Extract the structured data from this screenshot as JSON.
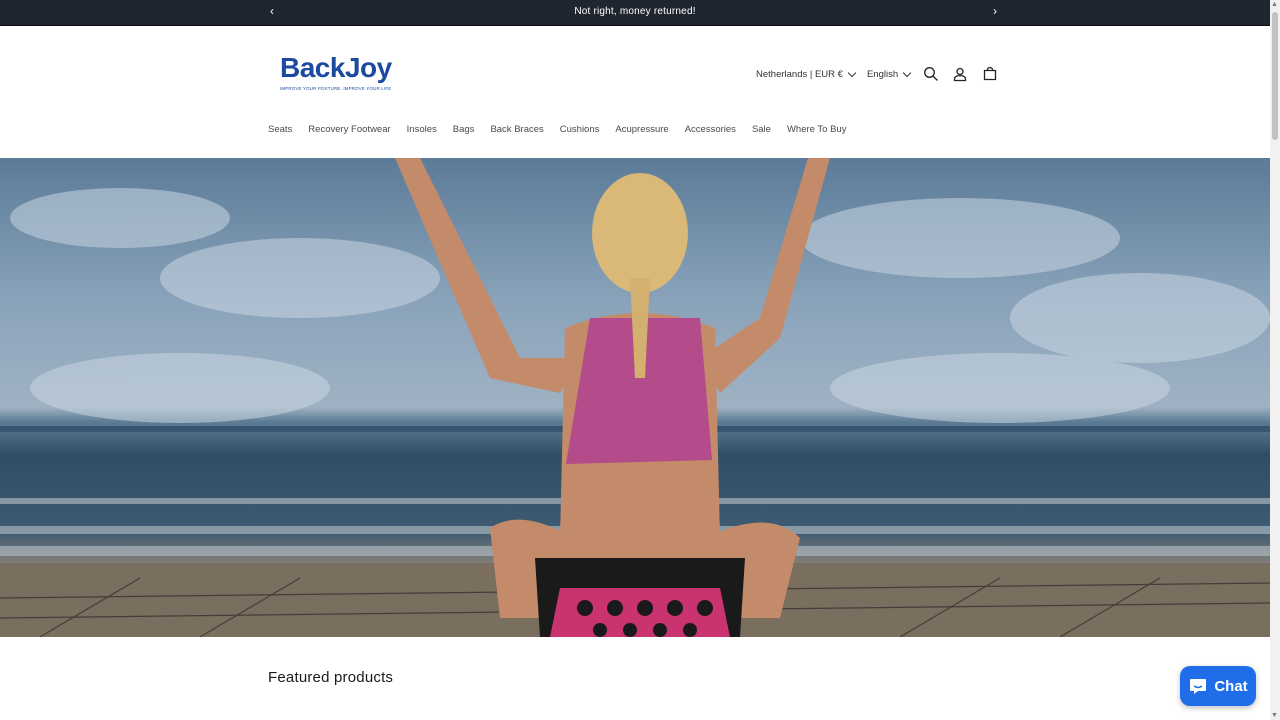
{
  "announcement": {
    "message": "Not right, money returned!",
    "prev_icon": "‹",
    "next_icon": "›"
  },
  "header": {
    "logo": {
      "name": "BackJoy",
      "tagline": "IMPROVE YOUR POSTURE. IMPROVE YOUR LIFE"
    },
    "country_selector": "Netherlands | EUR €",
    "language_selector": "English",
    "icons": [
      "search-icon",
      "account-icon",
      "cart-icon"
    ],
    "accent_color": "#1b4aa0"
  },
  "nav": {
    "items": [
      {
        "label": "Seats"
      },
      {
        "label": "Recovery Footwear"
      },
      {
        "label": "Insoles"
      },
      {
        "label": "Bags"
      },
      {
        "label": "Back Braces"
      },
      {
        "label": "Cushions"
      },
      {
        "label": "Acupressure"
      },
      {
        "label": "Accessories"
      },
      {
        "label": "Sale"
      },
      {
        "label": "Where To Buy"
      }
    ]
  },
  "hero": {
    "image": "woman-on-beach-with-seat-icon"
  },
  "featured": {
    "heading": "Featured products"
  },
  "chat": {
    "label": "Chat",
    "color": "#1f6de8"
  }
}
